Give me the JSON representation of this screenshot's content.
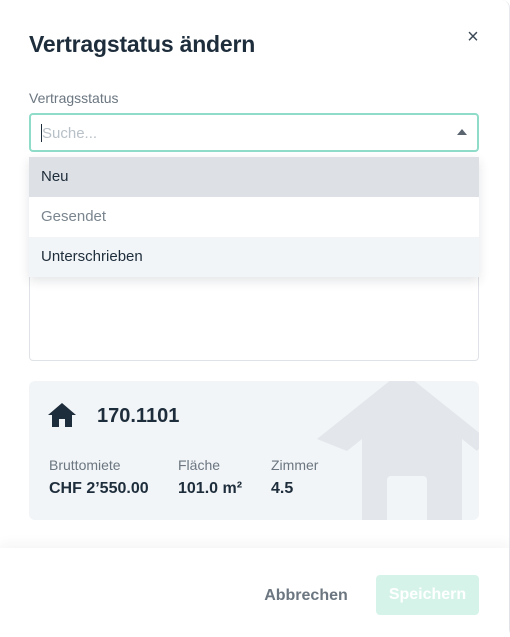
{
  "dialog": {
    "title": "Vertragstatus ändern",
    "close_symbol": "×"
  },
  "status_field": {
    "label": "Vertragsstatus",
    "placeholder": "Suche...",
    "options": [
      "Neu",
      "Gesendet",
      "Unterschrieben"
    ]
  },
  "unit_card": {
    "unit_id": "170.1101",
    "icon": "house-icon",
    "facts": [
      {
        "label": "Bruttomiete",
        "value": "CHF 2’550.00"
      },
      {
        "label": "Fläche",
        "value": "101.0 m²"
      },
      {
        "label": "Zimmer",
        "value": "4.5"
      }
    ]
  },
  "footer": {
    "cancel_label": "Abbrechen",
    "save_label": "Speichern"
  },
  "colors": {
    "accent": "#8fdcc8",
    "save_disabled_bg": "#d6f3ea",
    "card_bg": "#f2f5f7",
    "text_primary": "#1e2d3b",
    "text_muted": "#6b7680"
  }
}
